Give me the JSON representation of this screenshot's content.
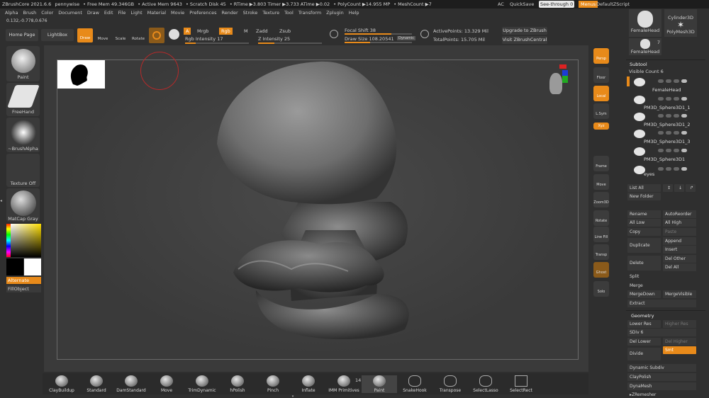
{
  "title_bar": {
    "app": "ZBrushCore 2021.6.6",
    "user": "pennywise",
    "free_mem": "• Free Mem 49.346GB",
    "active_mem": "• Active Mem 9643",
    "scratch": "• Scratch Disk 45",
    "rtime": "• RTime ▶3.803 Timer ▶3.733 ATime ▶0.02",
    "polycount": "• PolyCount ▶14.955 MP",
    "meshcount": "• MeshCount ▶7",
    "ac": "AC",
    "quicksave": "QuickSave",
    "seethrough": "See-through  0",
    "menus": "Menus",
    "script": "DefaultZScript"
  },
  "menus": [
    "Alpha",
    "Brush",
    "Color",
    "Document",
    "Draw",
    "Edit",
    "File",
    "Light",
    "Material",
    "Movie",
    "Preferences",
    "Render",
    "Stroke",
    "Texture",
    "Tool",
    "Transform",
    "Zplugin",
    "Help"
  ],
  "coords": "0.132,-0.778,0.676",
  "top_toolbar": {
    "home": "Home Page",
    "lightbox": "LightBox",
    "draw": "Draw",
    "move": "Move",
    "scale": "Scale",
    "rotate": "Rotate",
    "a": "A",
    "mrgb": "Mrgb",
    "rgb": "Rgb",
    "m": "M",
    "zadd": "Zadd",
    "zsub": "Zsub",
    "rgb_intensity": "Rgb Intensity 17",
    "z_intensity": "Z Intensity 25",
    "focal_shift": "Focal Shift 38",
    "draw_size": "Draw Size 108.20541",
    "dynamic": "Dynamic",
    "active_points": "ActivePoints: 13.329 Mil",
    "total_points": "TotalPoints: 15.705 Mil",
    "upgrade": "Upgrade to ZBrush",
    "visit": "Visit ZBrushCentral"
  },
  "progress": {
    "rgb_intensity": 0.17,
    "z_intensity": 0.25,
    "focal_shift": 0.69,
    "draw_size": 0.38
  },
  "left_panel": {
    "paint": "Paint",
    "freehand": "FreeHand",
    "brushalpha": "~BrushAlpha",
    "texture_off": "Texture Off",
    "matcap": "MatCap Gray",
    "alternate": "Alternate",
    "fillobject": "FillObject"
  },
  "right_vbar": [
    "Persp",
    "Floor",
    "Local",
    "L.Sym",
    "Xyz",
    "",
    "Frame",
    "Move",
    "Zoom3D",
    "Rotate",
    "Line Fill PolyF",
    "Transp",
    "Ghost",
    "Solo"
  ],
  "tool_thumbs": {
    "femalehead": "FemaleHead",
    "cylinder": "Cylinder3D",
    "polymesh": "PolyMesh3D",
    "femalehead2": "FemaleHead",
    "count": "7"
  },
  "subtool": {
    "title": "Subtool",
    "visible_count": "Visible Count 6",
    "items": [
      "FemaleHead",
      "PM3D_Sphere3D1_1",
      "PM3D_Sphere3D1_2",
      "PM3D_Sphere3D1_3",
      "PM3D_Sphere3D1",
      "eyes"
    ],
    "buttons": {
      "list_all": "List All",
      "new_folder": "New Folder",
      "rename": "Rename",
      "autoreorder": "AutoReorder",
      "all_low": "All Low",
      "all_high": "All High",
      "copy": "Copy",
      "paste": "Paste",
      "append": "Append",
      "duplicate": "Duplicate",
      "insert": "Insert",
      "del_other": "Del Other",
      "delete": "Delete",
      "del_all": "Del All",
      "split": "Split",
      "merge": "Merge",
      "mergedown": "MergeDown",
      "mergevisible": "MergeVisible",
      "extract": "Extract"
    }
  },
  "geometry": {
    "title": "Geometry",
    "lower_res": "Lower Res",
    "higher_res": "Higher Res",
    "sdiv": "SDiv 6",
    "del_lower": "Del Lower",
    "del_higher": "Del Higher",
    "divide": "Divide",
    "smt": "Smt",
    "dynamic_subdiv": "Dynamic Subdiv",
    "claypolish": "ClayPolish",
    "dynamesh": "DynaMesh",
    "zremesher": "▸ZRemesher"
  },
  "bottom_brushes": [
    "ClayBuildup",
    "Standard",
    "DamStandard",
    "Move",
    "TrimDynamic",
    "hPolish",
    "Pinch",
    "Inflate",
    "IMM Primitives",
    "Paint",
    "SnakeHook",
    "Transpose",
    "SelectLasso",
    "SelectRect"
  ],
  "imm_count": "14",
  "colors": {
    "accent": "#e88a1a",
    "panel": "#2f2f2f",
    "canvas": "#3a3a3a"
  }
}
